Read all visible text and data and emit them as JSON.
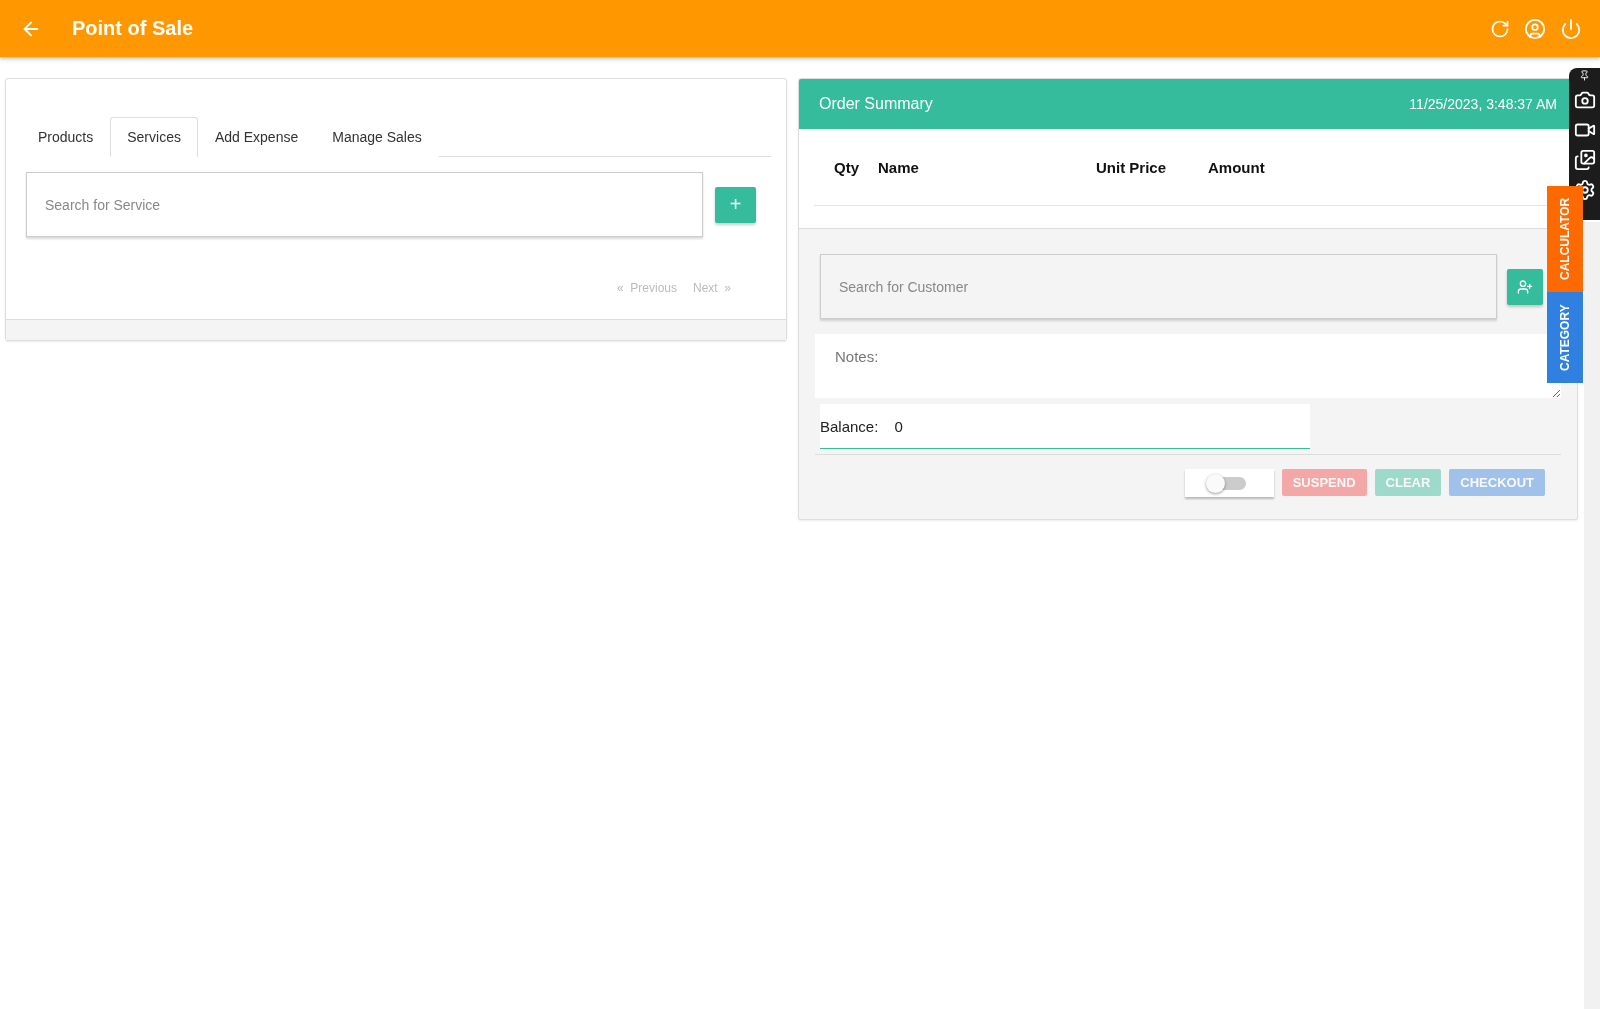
{
  "header": {
    "title": "Point of Sale"
  },
  "tabs": [
    {
      "label": "Products",
      "selected": false
    },
    {
      "label": "Services",
      "selected": true
    },
    {
      "label": "Add Expense",
      "selected": false
    },
    {
      "label": "Manage Sales",
      "selected": false
    }
  ],
  "service_search": {
    "placeholder": "Search for Service"
  },
  "add_button": {
    "label": "+"
  },
  "pagination": {
    "previous": "«  Previous",
    "next": "Next  »",
    "disabled": true
  },
  "order_summary": {
    "title": "Order Summary",
    "datetime": "11/25/2023, 3:48:37 AM",
    "columns": [
      "Qty",
      "Name",
      "Unit Price",
      "Amount"
    ],
    "customer_search": {
      "placeholder": "Search for Customer"
    },
    "notes": {
      "placeholder": "Notes:"
    },
    "balance": {
      "label": "Balance:",
      "value": "0"
    },
    "toggle": {
      "on": false
    },
    "actions": [
      {
        "label": "SUSPEND",
        "kind": "suspend",
        "disabled": true
      },
      {
        "label": "CLEAR",
        "kind": "clear",
        "disabled": true
      },
      {
        "label": "CHECKOUT",
        "kind": "checkout",
        "disabled": true
      }
    ]
  },
  "side_tabs": [
    {
      "label": "CALCULATOR",
      "color": "#ff6a00"
    },
    {
      "label": "CATEGORY",
      "color": "#2f80e0"
    }
  ]
}
